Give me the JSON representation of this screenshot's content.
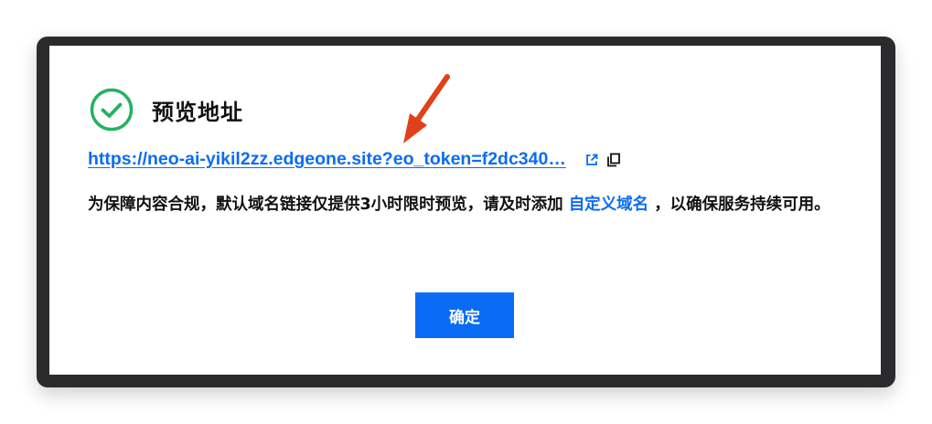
{
  "dialog": {
    "title": "预览地址",
    "status_icon": "check-circle-icon",
    "preview_url": "https://neo-ai-yikil2zz.edgeone.site?eo_token=f2dc340…",
    "open_icon": "external-link-icon",
    "copy_icon": "copy-icon",
    "notice_part1": "为保障内容合规，默认域名链接仅提供3小时限时预览，请及时添加",
    "custom_domain_link": "自定义域名",
    "notice_part2": "，以确保服务持续可用。",
    "confirm_label": "确定"
  },
  "colors": {
    "accent": "#0a6cf5",
    "success": "#22b35e",
    "annotation_arrow": "#e2401a",
    "frame": "#2b2b2d"
  }
}
